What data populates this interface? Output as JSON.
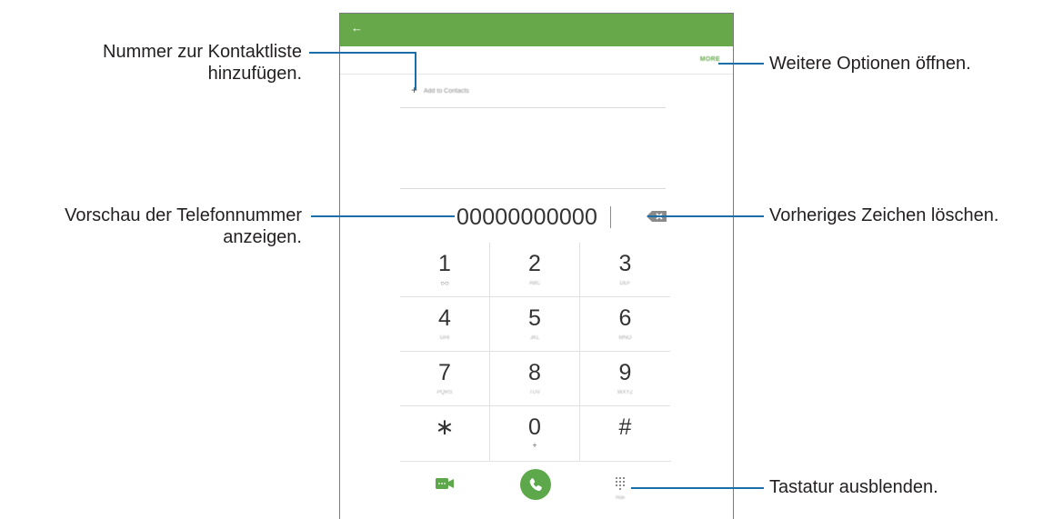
{
  "callouts": {
    "add_to_contacts_line1": "Nummer zur Kontaktliste",
    "add_to_contacts_line2": "hinzufügen.",
    "preview_line1": "Vorschau der Telefonnummer",
    "preview_line2": "anzeigen.",
    "more_options": "Weitere Optionen öffnen.",
    "delete_char": "Vorheriges Zeichen löschen.",
    "hide_keypad": "Tastatur ausblenden."
  },
  "phone": {
    "back_icon": "arrow-left-icon",
    "more_label": "MORE",
    "add_to_contacts": "Add to Contacts",
    "dialed_number": "00000000000",
    "hide_keypad_label": "Hide",
    "accent_color": "#66a84a",
    "keys": [
      {
        "main": "1",
        "sub": "○○"
      },
      {
        "main": "2",
        "sub": "ABC"
      },
      {
        "main": "3",
        "sub": "DEF"
      },
      {
        "main": "4",
        "sub": "GHI"
      },
      {
        "main": "5",
        "sub": "JKL"
      },
      {
        "main": "6",
        "sub": "MNO"
      },
      {
        "main": "7",
        "sub": "PQRS"
      },
      {
        "main": "8",
        "sub": "TUV"
      },
      {
        "main": "9",
        "sub": "WXYZ"
      },
      {
        "main": "∗",
        "sub": ""
      },
      {
        "main": "0",
        "sub": "+"
      },
      {
        "main": "#",
        "sub": ""
      }
    ]
  }
}
